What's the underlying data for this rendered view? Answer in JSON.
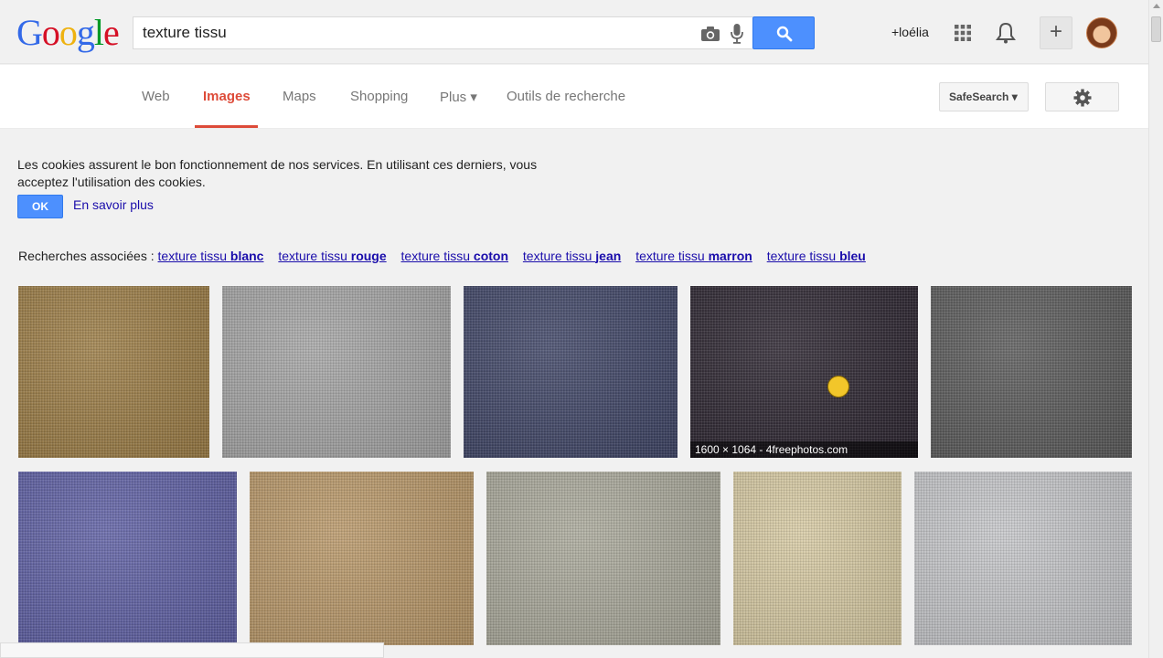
{
  "logo": {
    "letters": [
      "G",
      "o",
      "o",
      "g",
      "l",
      "e"
    ],
    "colors": [
      "#3369e8",
      "#d50f25",
      "#eeb211",
      "#3369e8",
      "#009925",
      "#d50f25"
    ]
  },
  "search": {
    "value": "texture tissu"
  },
  "user": {
    "name": "+loélia"
  },
  "icons": {
    "camera": "camera-icon",
    "mic": "mic-icon",
    "search": "search-icon",
    "apps": "apps-grid-icon",
    "bell": "bell-icon",
    "plus": "plus-icon",
    "gear": "gear-icon"
  },
  "share_label": "+",
  "nav": {
    "items": [
      "Web",
      "Images",
      "Maps",
      "Shopping",
      "Plus ▾",
      "Outils de recherche"
    ],
    "active": "Images"
  },
  "safesearch": {
    "label": "SafeSearch ▾"
  },
  "cookie": {
    "text": "Les cookies assurent le bon fonctionnement de nos services. En utilisant ces derniers, vous acceptez l'utilisation des cookies.",
    "ok": "OK",
    "more": "En savoir plus"
  },
  "related": {
    "label": "Recherches associées :",
    "items": [
      {
        "prefix": "texture tissu ",
        "bold": "blanc"
      },
      {
        "prefix": "texture tissu ",
        "bold": "rouge"
      },
      {
        "prefix": "texture tissu ",
        "bold": "coton"
      },
      {
        "prefix": "texture tissu ",
        "bold": "jean"
      },
      {
        "prefix": "texture tissu ",
        "bold": "marron"
      },
      {
        "prefix": "texture tissu ",
        "bold": "bleu"
      }
    ]
  },
  "images": {
    "row1": [
      {
        "color": "#9b7c45"
      },
      {
        "color": "#a4a4a4"
      },
      {
        "color": "#3f4566"
      },
      {
        "color": "#2c2530",
        "caption": "1600 × 1064 - 4freephotos.com"
      },
      {
        "color": "#5a5a5a"
      }
    ],
    "row2": [
      {
        "color": "#5e5fa3"
      },
      {
        "color": "#b89768"
      },
      {
        "color": "#a9a89a"
      },
      {
        "color": "#d6c9a2"
      },
      {
        "color": "#c4c5c8"
      }
    ]
  }
}
